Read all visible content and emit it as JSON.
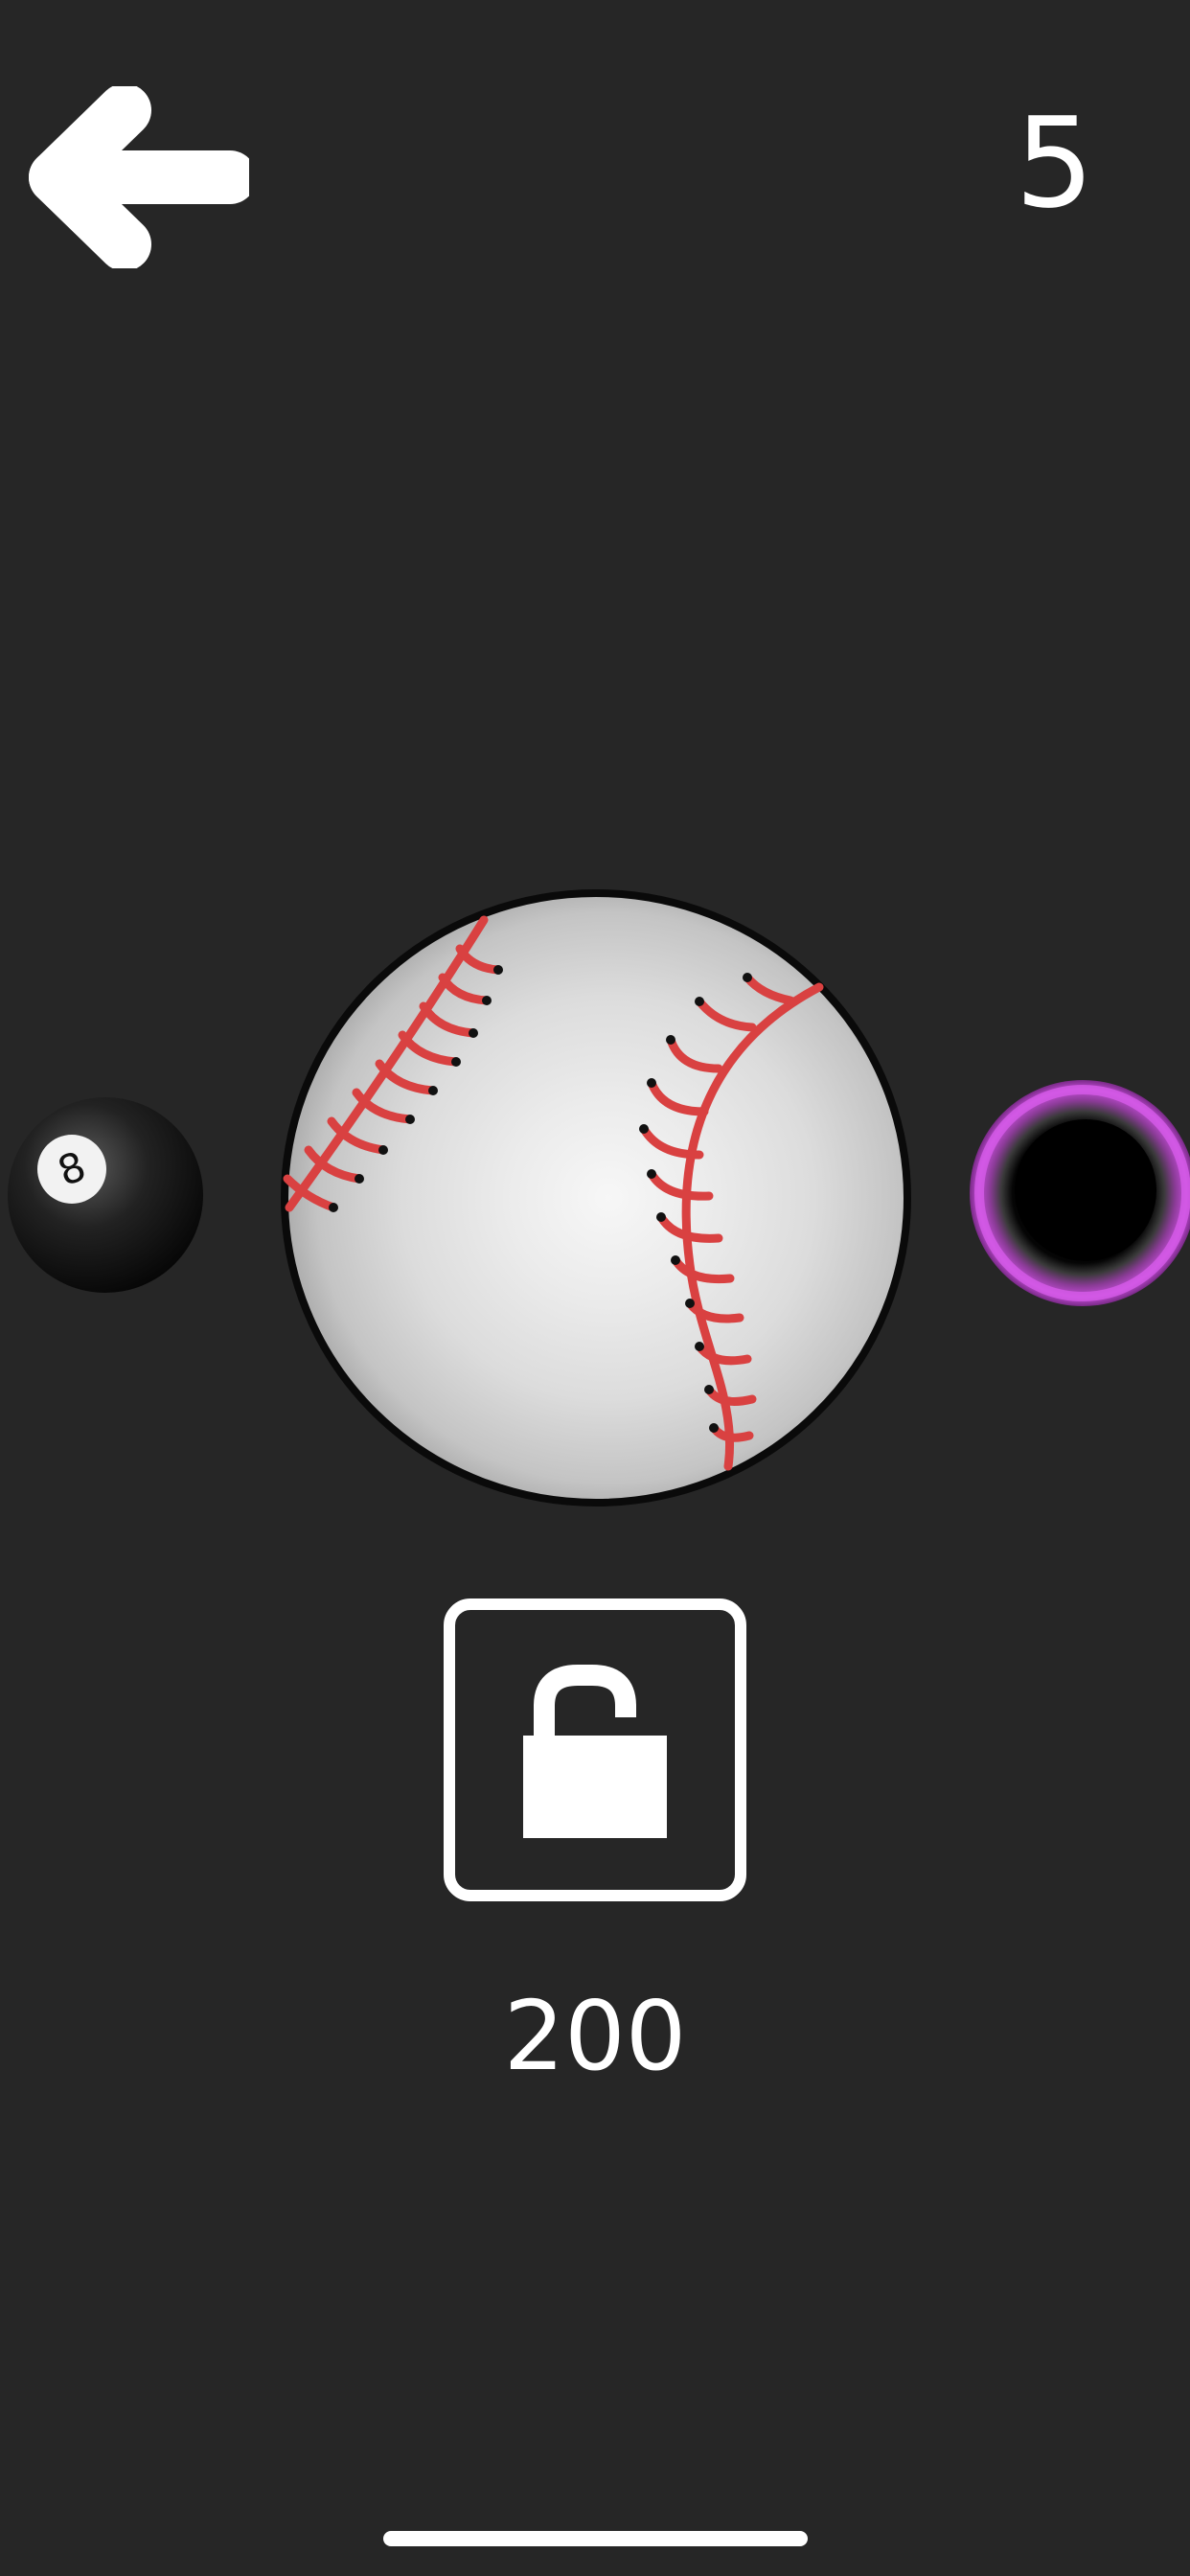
{
  "header": {
    "back_icon": "arrow-left-icon",
    "score": "5"
  },
  "carousel": {
    "left_item": {
      "icon": "eight-ball-icon",
      "label": "8"
    },
    "center_item": {
      "icon": "baseball-icon"
    },
    "right_item": {
      "icon": "black-hole-icon"
    }
  },
  "unlock": {
    "icon": "unlocked-padlock-icon",
    "price": "200"
  },
  "colors": {
    "background": "#262626",
    "foreground": "#ffffff",
    "stitch_red": "#d94141",
    "portal_purple": "#c44dd8"
  }
}
